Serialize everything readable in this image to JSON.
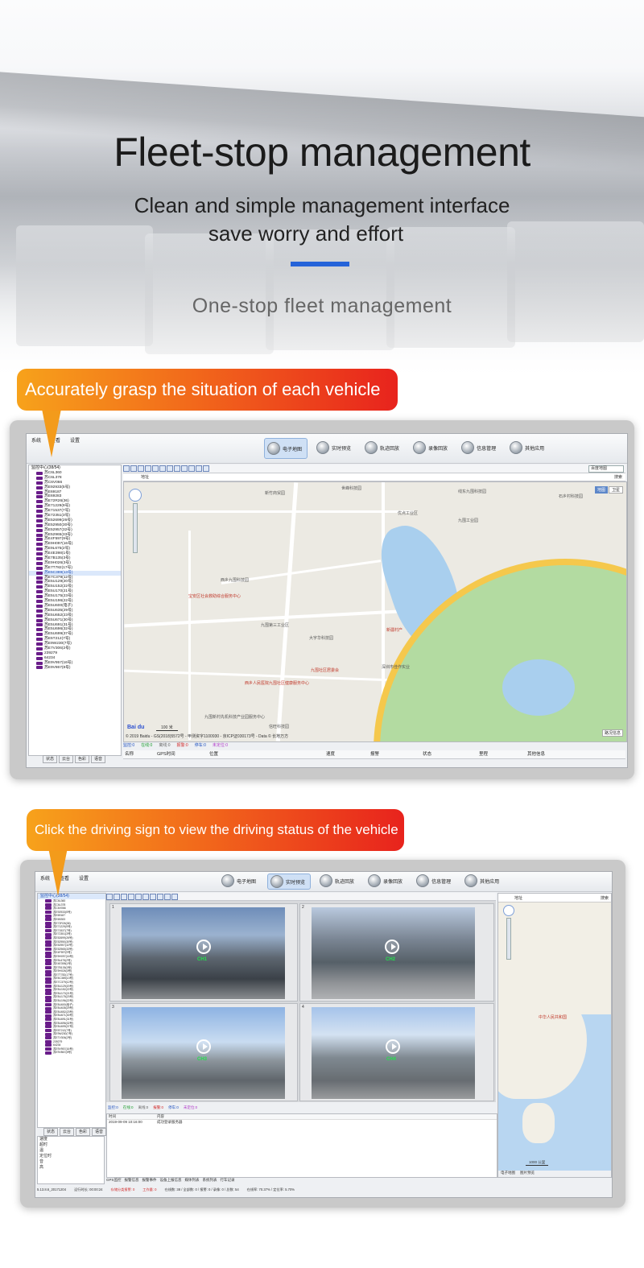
{
  "hero": {
    "title": "Fleet-stop management",
    "subtitle_line1": "Clean and simple management interface",
    "subtitle_line2": "save worry and effort",
    "tagline": "One-stop fleet management",
    "accent_color": "#2563d9"
  },
  "callouts": {
    "first": "Accurately grasp the situation of each vehicle",
    "second": "Click the driving sign to view the driving status of the vehicle"
  },
  "app1": {
    "menu": [
      "系统",
      "查看",
      "设置"
    ],
    "nav_tabs": [
      "电子地图",
      "实时预览",
      "轨迹回放",
      "录像回放",
      "信息管理",
      "其他应用"
    ],
    "active_tab": "电子地图",
    "tree_root": "监控中心(38/54)",
    "tree_items": [
      "苏C6L360",
      "苏C6L378",
      "苏C6V066",
      "苏E92933(5号)",
      "苏E69187",
      "苏E69283",
      "苏E72R26(36)",
      "苏E71229(9号)",
      "苏E71537(7号)",
      "苏E72351(3号)",
      "苏E52699(26号)",
      "苏E52950(30号)",
      "苏E52957(32号)",
      "苏E52965(33号)",
      "苏E4F597(9号)",
      "苏E9H097(16号)",
      "苏E9L675(2号)",
      "苏E4E398(1号)",
      "苏E7B135(3号)",
      "苏E9H026(3号)",
      "苏E7T782(17号)",
      "苏E5C389(13号)",
      "苏E7C379(12号)",
      "苏E5U129(20号)",
      "苏E5U152(22号)",
      "苏E5U170(21号)",
      "苏E5U175(23号)",
      "苏E5U196(22号)",
      "苏E5U600(电子)",
      "苏E5U635(29号)",
      "苏E5U652(23号)",
      "苏E5U671(30号)",
      "苏E5U691(31号)",
      "苏E5U696(32号)",
      "苏E5U699(37号)",
      "苏E5T212(7号)",
      "苏E9W230(7号)",
      "苏E7V306(2号)",
      "239279",
      "64234",
      "苏E9V957(16号)",
      "苏E9V867(8号)"
    ],
    "selected_item": "苏E5C389(13号)",
    "tree_tabs": [
      "状态",
      "云台",
      "色彩",
      "语音"
    ],
    "map_type_select": "百度地图",
    "map_address_label": "地址",
    "map_search": "搜索",
    "map_mode_buttons": [
      "地图",
      "卫星"
    ],
    "scale": "100 米",
    "copyright": "© 2019 Baidu - GS(2018)5572号 - 甲测资字1100930 - 京ICP证030173号 - Data © 长地万方",
    "road_info": "路况信息",
    "status_counts": [
      "监控:0",
      "在线:0",
      "离线:0",
      "报警:0",
      "停车:0",
      "未定位:0"
    ],
    "grid_columns": [
      "名称",
      "GPS时间",
      "位置",
      "速度",
      "报警",
      "状态",
      "里程",
      "其他信息"
    ],
    "poi": [
      {
        "text": "世峰科技园",
        "red": false
      },
      {
        "text": "线东九围科技园",
        "red": false
      },
      {
        "text": "优点工业区",
        "red": false
      },
      {
        "text": "石乡村科技园",
        "red": false
      },
      {
        "text": "九围工业园",
        "red": false
      },
      {
        "text": "新竹商贸园",
        "red": false
      },
      {
        "text": "九围社区居委会",
        "red": true
      },
      {
        "text": "宝安区社会救助综合服务中心",
        "red": true
      },
      {
        "text": "西乡人民医院九围社区健康服务中心",
        "red": true
      },
      {
        "text": "新疆村产",
        "red": true
      },
      {
        "text": "深圳市佳作实业",
        "red": false
      },
      {
        "text": "大宇华科技园",
        "red": false
      },
      {
        "text": "九围第三工业区",
        "red": false
      },
      {
        "text": "九围新村先机科技产业园服务中心",
        "red": false
      },
      {
        "text": "西乡九围科技园",
        "red": false
      },
      {
        "text": "信旺科技园",
        "red": false
      }
    ]
  },
  "app2": {
    "menu": [
      "系统",
      "查看",
      "设置"
    ],
    "nav_tabs": [
      "电子地图",
      "实时预览",
      "轨迹回放",
      "录像回放",
      "信息管理",
      "其他应用"
    ],
    "active_tab": "实时预览",
    "tree_root": "监控中心(38/54)",
    "tree_items": [
      "苏C6L360",
      "苏C6L378",
      "苏C6V066",
      "苏E92933(5号)",
      "苏E69187",
      "苏E69283",
      "苏E72R26(36)",
      "苏E71229(9号)",
      "苏E71537(7号)",
      "苏E72351(3号)",
      "苏E52699(26号)",
      "苏E52950(30号)",
      "苏E52957(32号)",
      "苏E52965(33号)",
      "苏E4F597(9号)",
      "苏E9H097(16号)",
      "苏E9L675(2号)",
      "苏E4E398(1号)",
      "苏E7B135(3号)",
      "苏E9H026(3号)",
      "苏E7T782(17号)",
      "苏E5C389(13号)",
      "苏E7C379(12号)",
      "苏E5U129(20号)",
      "苏E5U152(22号)",
      "苏E5U170(21号)",
      "苏E5U175(23号)",
      "苏E5U196(22号)",
      "苏E5U600(电子)",
      "苏E5U635(29号)",
      "苏E5U652(23号)",
      "苏E5U671(30号)",
      "苏E5U691(31号)",
      "苏E5U696(32号)",
      "苏E5U699(37号)",
      "苏E5T212(7号)",
      "苏E9W230(7号)",
      "苏E7V306(2号)",
      "239279",
      "64234",
      "苏E9V957(16号)",
      "苏E9V867(8号)"
    ],
    "tree_tabs": [
      "状态",
      "云台",
      "色彩",
      "语音"
    ],
    "props": [
      "速度",
      "超时",
      "温",
      "定位时",
      "音",
      "高"
    ],
    "video_cells": [
      {
        "num": "1",
        "channel": "CH1"
      },
      {
        "num": "2",
        "channel": "CH2"
      },
      {
        "num": "3",
        "channel": "CH3"
      },
      {
        "num": "4",
        "channel": "CH4"
      }
    ],
    "status_counts": [
      "监控:0",
      "在线:0",
      "离线:0",
      "报警:0",
      "停车:0",
      "未定位:0"
    ],
    "log_head": [
      "时间",
      "内容"
    ],
    "log_row": [
      "2019-09-09 10:16:00",
      "成功登录服务器"
    ],
    "bottom_tabs": [
      "GPS监控",
      "报警信息",
      "报警事件",
      "设备上报信息",
      "媒体列表",
      "系统列表",
      "行车记录"
    ],
    "status_bar": [
      "5.13.8.6_20171204",
      "运行时长: 00:00:24",
      "存储分类报警: 0",
      "工作量: 0",
      "在线数: 38 / 全部数: 0 / 报警: 0 / 录像: 0 / 总数: 54",
      "在线率: 70.37% / 定位率: 5.70%"
    ],
    "map_label": "中华人民共和国",
    "map_address_label": "地址",
    "map_search": "搜索",
    "map_tabs": [
      "电子地图",
      "图片预览"
    ],
    "scale": "1000 公里"
  }
}
